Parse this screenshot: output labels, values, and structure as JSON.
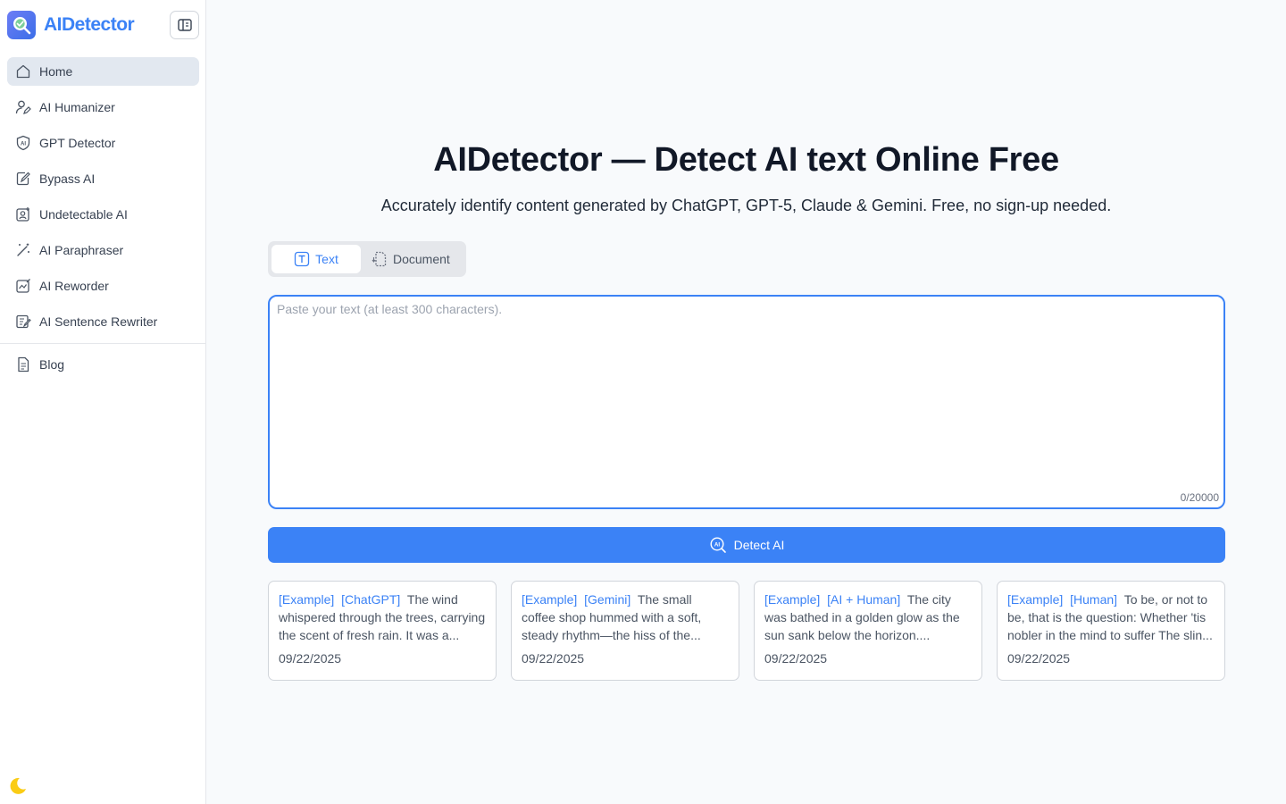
{
  "app": {
    "name": "AIDetector"
  },
  "sidebar": {
    "items": [
      {
        "label": "Home",
        "icon": "home-icon"
      },
      {
        "label": "AI Humanizer",
        "icon": "user-pen-icon"
      },
      {
        "label": "GPT Detector",
        "icon": "shield-ai-icon"
      },
      {
        "label": "Bypass AI",
        "icon": "file-pen-icon"
      },
      {
        "label": "Undetectable AI",
        "icon": "user-square-icon"
      },
      {
        "label": "AI Paraphraser",
        "icon": "magic-wand-icon"
      },
      {
        "label": "AI Reworder",
        "icon": "chart-pen-icon"
      },
      {
        "label": "AI Sentence Rewriter",
        "icon": "notebook-pen-icon"
      }
    ],
    "blog": {
      "label": "Blog",
      "icon": "document-icon"
    }
  },
  "main": {
    "title": "AIDetector — Detect AI text Online Free",
    "subtitle": "Accurately identify content generated by ChatGPT, GPT-5, Claude & Gemini. Free, no sign-up needed.",
    "tabs": [
      {
        "label": "Text",
        "active": true
      },
      {
        "label": "Document",
        "active": false
      }
    ],
    "input": {
      "placeholder": "Paste your text (at least 300 characters).",
      "value": "",
      "counter": "0/20000"
    },
    "detect_button": "Detect AI",
    "examples": [
      {
        "tag1": "[Example]",
        "tag2": "[ChatGPT]",
        "text": "The wind whispered through the trees, carrying the scent of fresh rain. It was a...",
        "date": "09/22/2025"
      },
      {
        "tag1": "[Example]",
        "tag2": "[Gemini]",
        "text": "The small coffee shop hummed with a soft, steady rhythm—the hiss of the...",
        "date": "09/22/2025"
      },
      {
        "tag1": "[Example]",
        "tag2": "[AI + Human]",
        "text": "The city was bathed in a golden glow as the sun sank below the horizon....",
        "date": "09/22/2025"
      },
      {
        "tag1": "[Example]",
        "tag2": "[Human]",
        "text": "To be, or not to be, that is the question: Whether 'tis nobler in the mind to suffer The slin...",
        "date": "09/22/2025"
      }
    ]
  },
  "colors": {
    "accent": "#3b82f6",
    "active_nav": "#e2e8f0",
    "moon": "#facc15"
  }
}
